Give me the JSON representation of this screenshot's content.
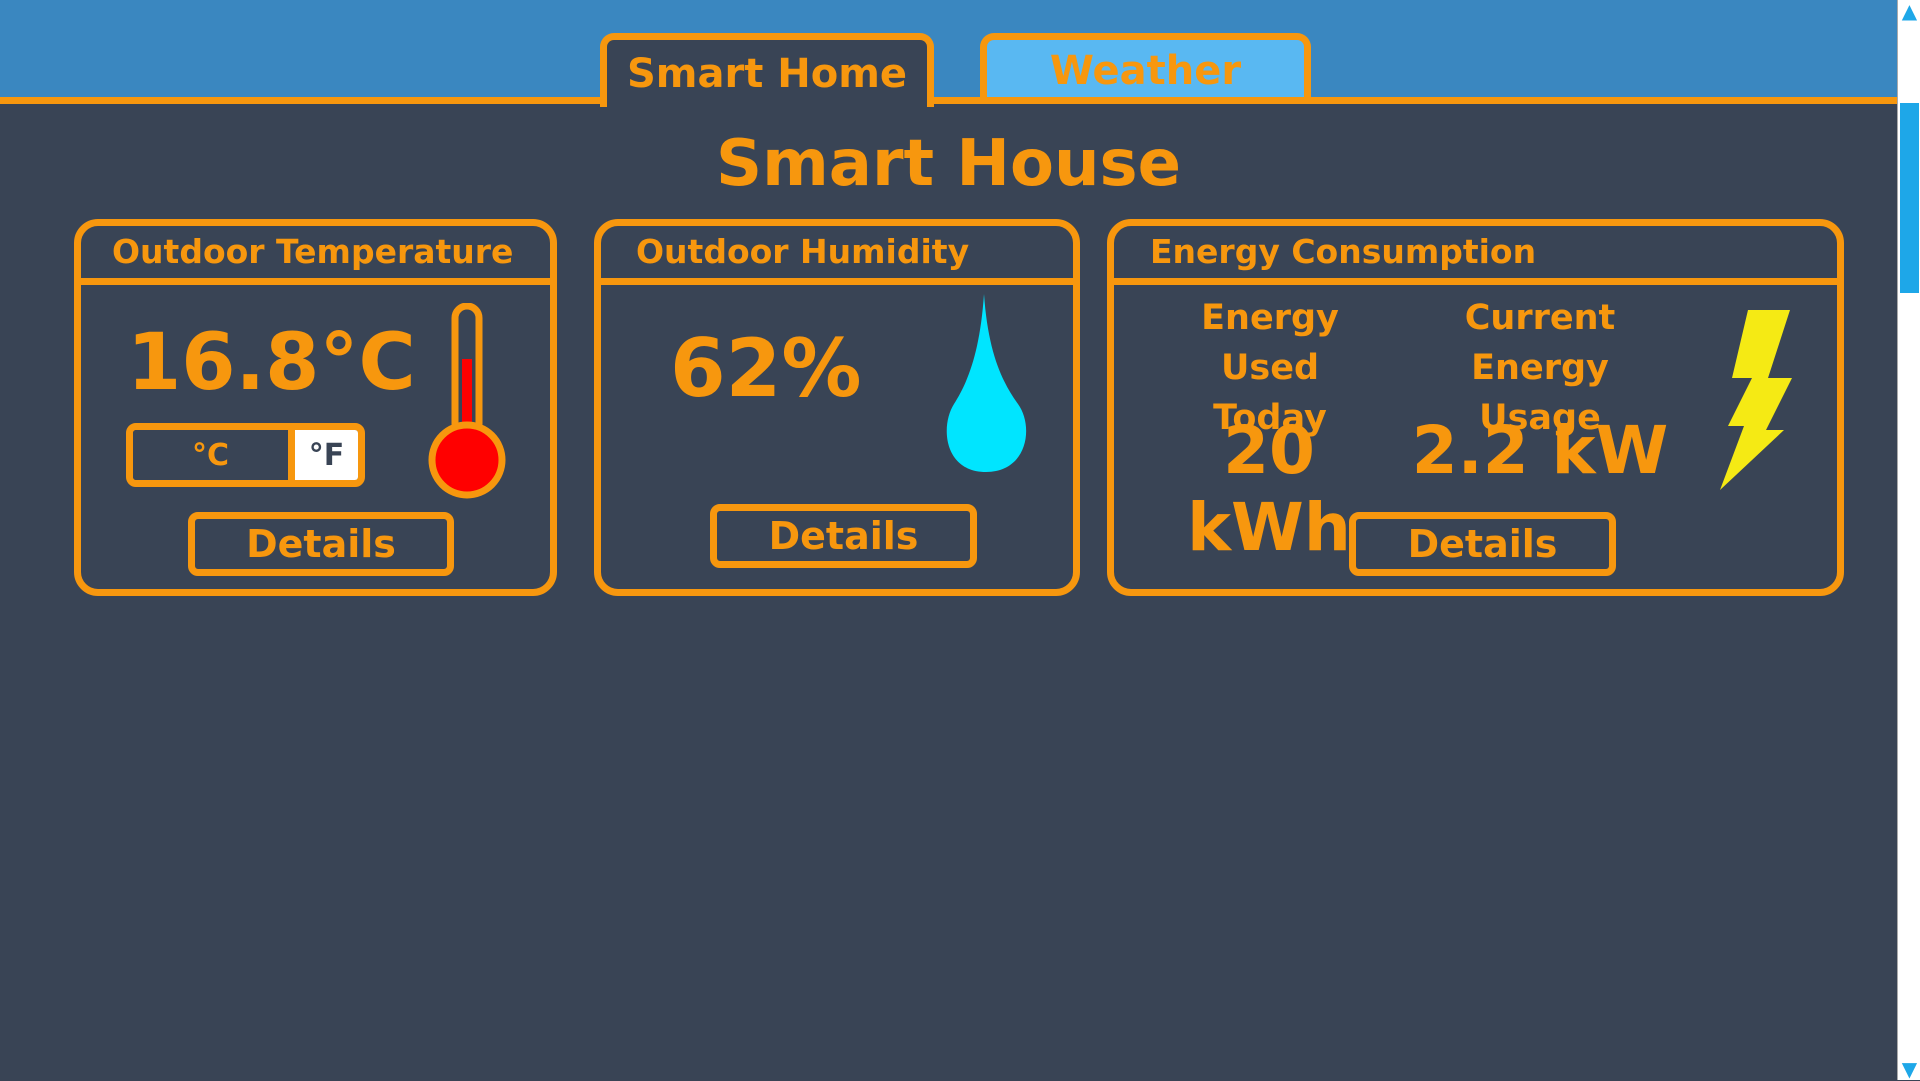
{
  "tabs": [
    {
      "label": "Smart Home",
      "active": true
    },
    {
      "label": "Weather",
      "active": false
    }
  ],
  "page_title": "Smart House",
  "colors": {
    "accent": "#f7970e",
    "background": "#394455",
    "topbar": "#3a87c0",
    "inactive_tab": "#59b8f2",
    "water": "#00e5ff",
    "thermometer": "#ff0000",
    "lightning": "#f5ea14"
  },
  "temperature_card": {
    "title": "Outdoor Temperature",
    "value": "16.8°C",
    "unit_c": "°C",
    "unit_f": "°F",
    "icon": "thermometer-icon",
    "details_label": "Details"
  },
  "humidity_card": {
    "title": "Outdoor Humidity",
    "value": "62%",
    "icon": "water-drop-icon",
    "details_label": "Details"
  },
  "energy_card": {
    "title": "Energy Consumption",
    "used_today_label_1": "Energy Used",
    "used_today_label_2": "Today",
    "used_today_value": "20 kWh",
    "current_label_1": "Current Energy",
    "current_label_2": "Usage",
    "current_value": "2.2 kW",
    "icon": "lightning-icon",
    "details_label": "Details"
  },
  "scrollbar": {
    "up_icon": "▲",
    "down_icon": "▼"
  }
}
